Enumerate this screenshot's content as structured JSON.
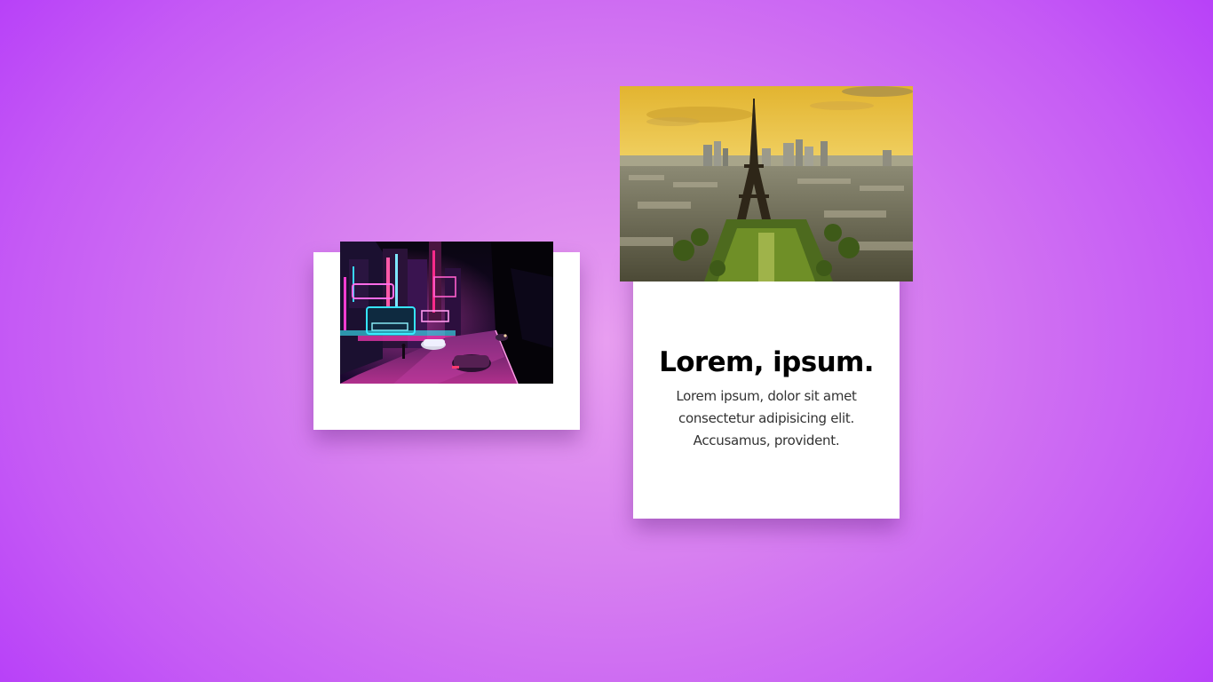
{
  "background": {
    "gradient_center": "#e89ef0",
    "gradient_edge": "#b032fa"
  },
  "cards": [
    {
      "id": "neon-city-card",
      "image": "neon-city-street-photo"
    },
    {
      "id": "paris-card",
      "image": "eiffel-tower-paris-photo",
      "title": "Lorem, ipsum.",
      "text": "Lorem ipsum, dolor sit amet consectetur adipisicing elit. Accusamus, provident."
    }
  ],
  "colors": {
    "card_bg": "#ffffff",
    "title": "#000000",
    "body_text": "#333333"
  }
}
